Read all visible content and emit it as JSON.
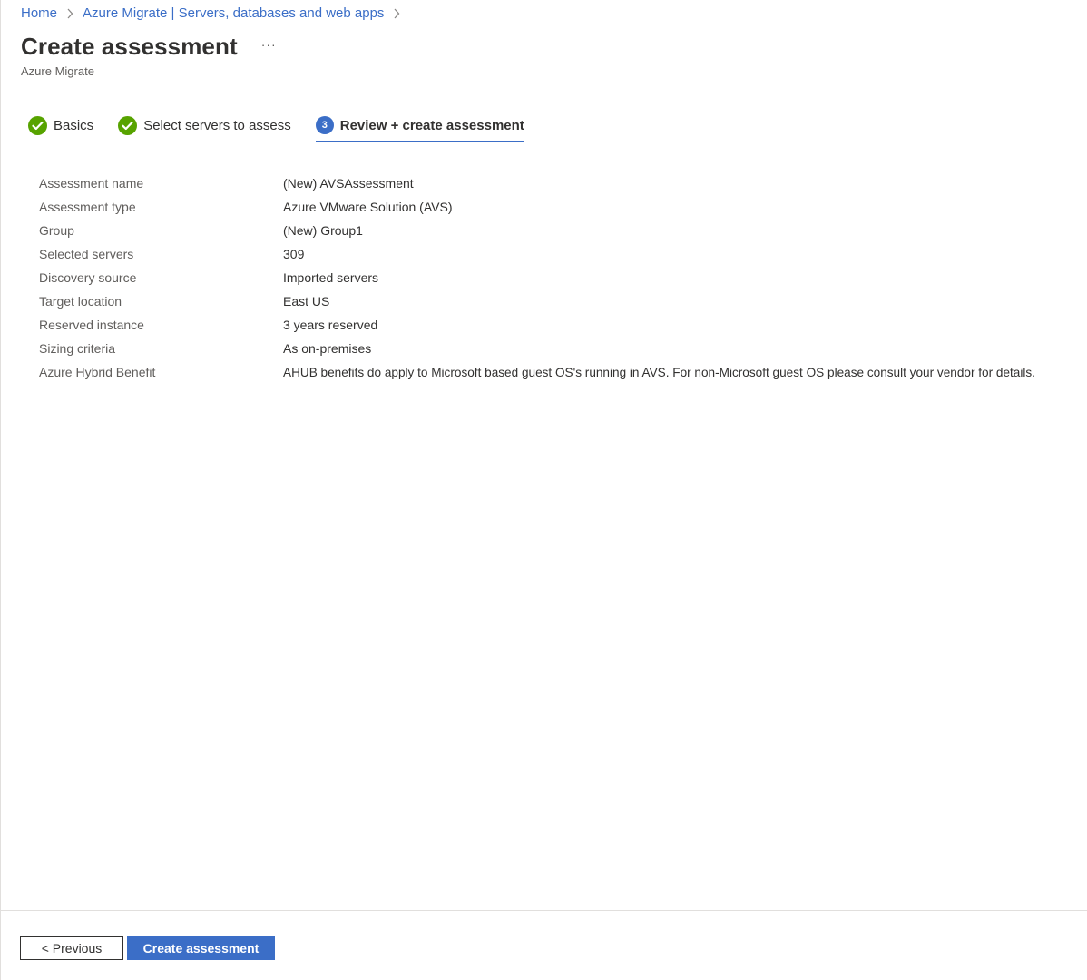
{
  "breadcrumb": {
    "items": [
      {
        "label": "Home"
      },
      {
        "label": "Azure Migrate | Servers, databases and web apps"
      }
    ]
  },
  "header": {
    "title": "Create assessment",
    "more_label": "···",
    "subtitle": "Azure Migrate"
  },
  "wizard": {
    "steps": [
      {
        "label": "Basics",
        "status": "complete",
        "icon": "check-icon"
      },
      {
        "label": "Select servers to assess",
        "status": "complete",
        "icon": "check-icon"
      },
      {
        "label": "Review + create assessment",
        "status": "active",
        "number": "3"
      }
    ]
  },
  "summary": {
    "rows": [
      {
        "key": "Assessment name",
        "value": "(New) AVSAssessment"
      },
      {
        "key": "Assessment type",
        "value": "Azure VMware Solution (AVS)"
      },
      {
        "key": "Group",
        "value": "(New) Group1"
      },
      {
        "key": "Selected servers",
        "value": "309"
      },
      {
        "key": "Discovery source",
        "value": "Imported servers"
      },
      {
        "key": "Target location",
        "value": "East US"
      },
      {
        "key": "Reserved instance",
        "value": "3 years reserved"
      },
      {
        "key": "Sizing criteria",
        "value": "As on-premises"
      },
      {
        "key": "Azure Hybrid Benefit",
        "value": "AHUB benefits do apply to Microsoft based guest OS's running in AVS. For non-Microsoft guest OS please consult your vendor for details."
      }
    ]
  },
  "footer": {
    "previous_label": "< Previous",
    "create_label": "Create assessment"
  },
  "colors": {
    "accent": "#3b6ec7",
    "success": "#57a300",
    "text": "#323130",
    "muted": "#605e5c"
  }
}
